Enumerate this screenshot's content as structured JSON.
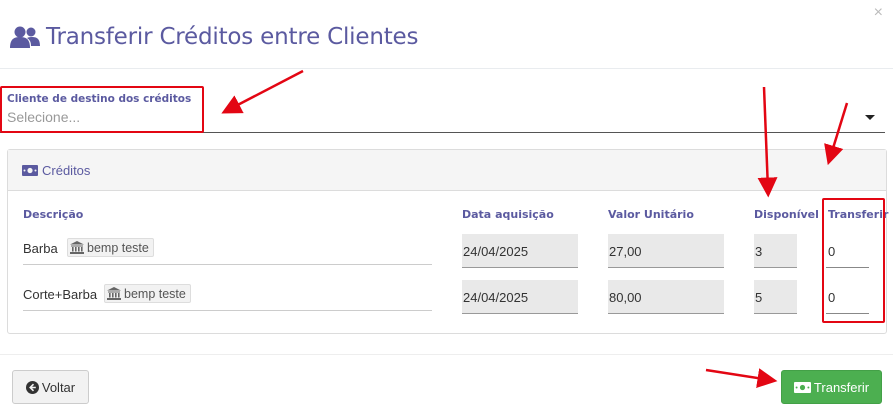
{
  "header": {
    "title": "Transferir Créditos entre Clientes",
    "close_symbol": "×"
  },
  "client_select": {
    "label": "Cliente de destino dos créditos",
    "placeholder": "Selecione..."
  },
  "credits_card": {
    "title": "Créditos",
    "columns": {
      "descricao": "Descrição",
      "data_aquisicao": "Data aquisição",
      "valor_unitario": "Valor Unitário",
      "disponivel": "Disponível",
      "transferir": "Transferir"
    },
    "rows": [
      {
        "descricao": "Barba",
        "badge": "bemp teste",
        "data_aquisicao": "24/04/2025",
        "valor_unitario": "27,00",
        "disponivel": "3",
        "transferir": "0"
      },
      {
        "descricao": "Corte+Barba",
        "badge": "bemp teste",
        "data_aquisicao": "24/04/2025",
        "valor_unitario": "80,00",
        "disponivel": "5",
        "transferir": "0"
      }
    ]
  },
  "footer": {
    "back_label": "Voltar",
    "transfer_label": "Transferir"
  },
  "colors": {
    "accent": "#5b5aa0",
    "success": "#4caf50",
    "annotation": "#e30613"
  }
}
